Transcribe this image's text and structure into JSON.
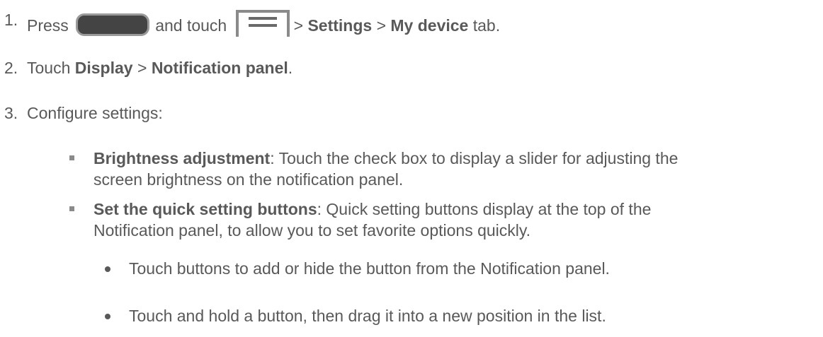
{
  "steps": [
    {
      "number": "1.",
      "press": "Press",
      "and_touch": "and touch",
      "sep1": ">",
      "settings": "Settings",
      "sep2": ">",
      "my_device": "My device",
      "tab": "tab."
    },
    {
      "number": "2.",
      "touch": "Touch",
      "display": "Display",
      "sep": ">",
      "notification_panel": "Notification panel",
      "period": "."
    },
    {
      "number": "3.",
      "text": "Configure settings:"
    }
  ],
  "bullets": [
    {
      "title": "Brightness adjustment",
      "line1": ": Touch the check box to display a slider for adjusting the",
      "line2": "screen brightness on the notification panel."
    },
    {
      "title": "Set the quick setting buttons",
      "line1": ": Quick setting buttons display at the top of the",
      "line2": "Notification panel, to allow you to set favorite options quickly."
    }
  ],
  "sub_bullets": [
    "Touch buttons to add or hide the button from the Notification panel.",
    "Touch and hold a button, then drag it into a new position in the list."
  ],
  "icons": [
    "home-key-icon",
    "menu-key-icon"
  ],
  "colors": {
    "text": "#595959",
    "home_key": "#444444",
    "icon_border": "#8a8a8a"
  }
}
